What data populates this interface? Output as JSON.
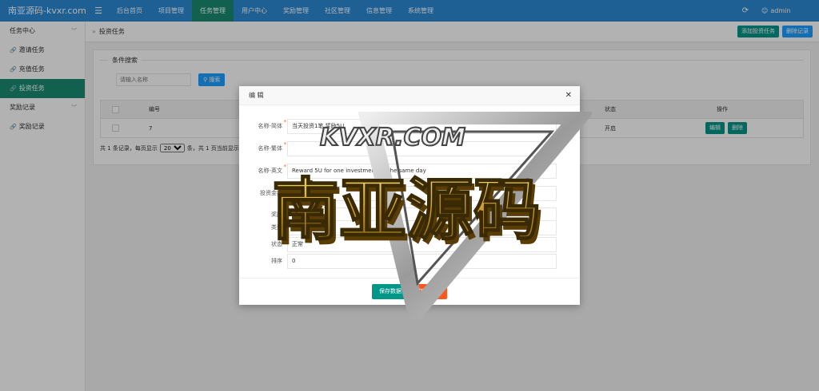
{
  "brand": "南亚源码-kvxr.com",
  "nav": [
    "后台首页",
    "项目管理",
    "任务管理",
    "用户中心",
    "奖励管理",
    "社区管理",
    "信息管理",
    "系统管理"
  ],
  "user": {
    "name": "admin"
  },
  "sidebar": {
    "group1": "任务中心",
    "items1": [
      "邀请任务",
      "充值任务",
      "投资任务"
    ],
    "group2": "奖励记录",
    "items2": [
      "奖励记录"
    ]
  },
  "breadcrumb": "投资任务",
  "actions": {
    "add": "添加投资任务",
    "delete": "删除记录"
  },
  "search": {
    "legend": "条件搜索",
    "placeholder": "请输入名称",
    "button": "搜索"
  },
  "table": {
    "headers": {
      "id": "编号",
      "status": "状态",
      "ops": "操作"
    },
    "rows": [
      {
        "id": "7",
        "status": "开启",
        "edit": "编辑",
        "delete": "删除"
      }
    ]
  },
  "pager": {
    "prefix": "共 1 条记录，每页显示",
    "size": "20",
    "suffix": "条，共 1 页当前显示第 1 页"
  },
  "modal": {
    "title": "编 辑",
    "fields": [
      {
        "label": "名称-简体",
        "value": "当天投资1笔 奖励5U"
      },
      {
        "label": "名称-繁体",
        "value": ""
      },
      {
        "label": "名称-英文",
        "value": "Reward 5U for one investment on the same day"
      },
      {
        "label": "投资金额",
        "value": ""
      },
      {
        "label": "奖励",
        "value": "10.00"
      },
      {
        "label": "类型",
        "value": ""
      },
      {
        "label": "状态",
        "value": "正常"
      },
      {
        "label": "排序",
        "value": "0"
      }
    ],
    "save": "保存数据",
    "cancel": "取消编辑"
  },
  "watermark": {
    "top": "KVXR.COM",
    "main": "南亚源码"
  }
}
